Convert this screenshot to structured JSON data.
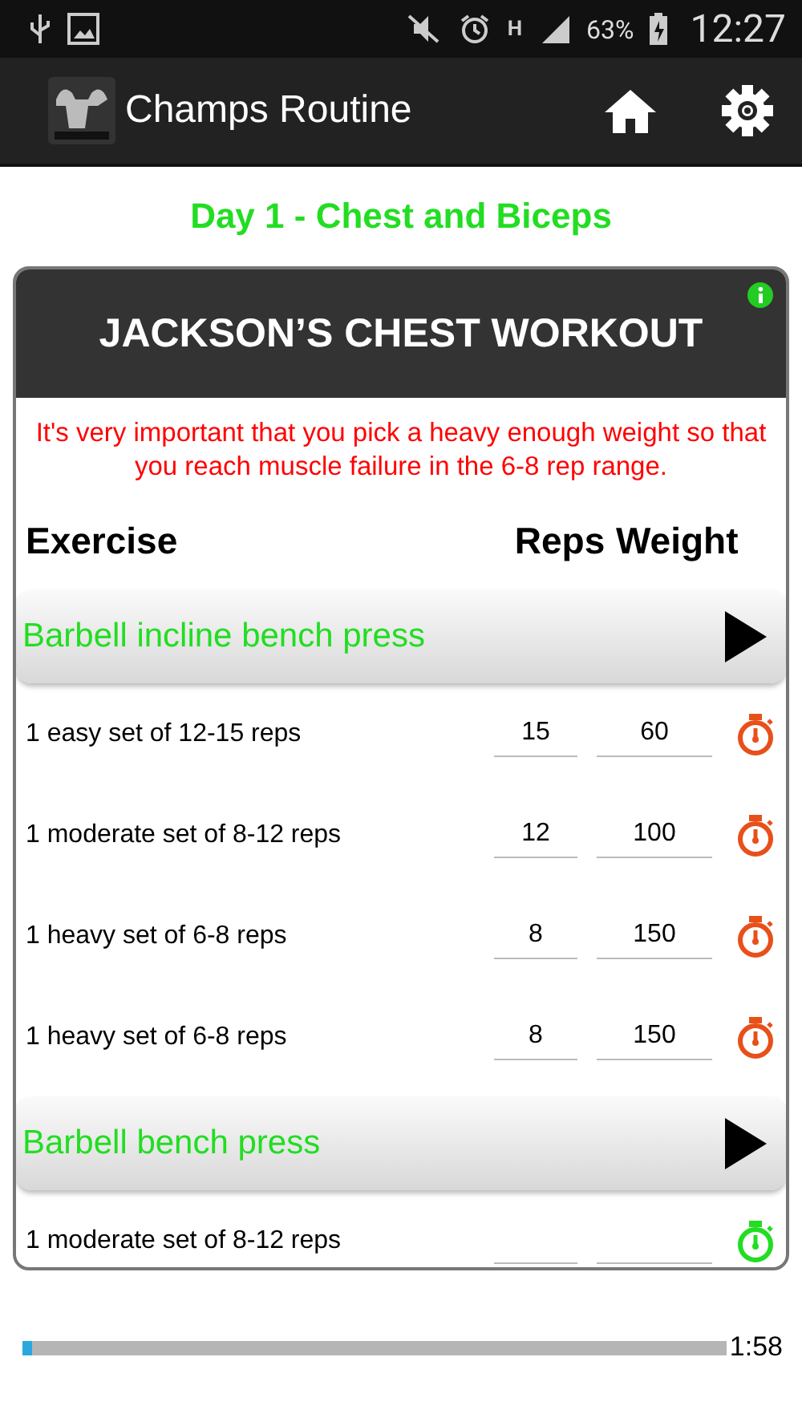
{
  "status_bar": {
    "battery_text": "63%",
    "network": "H",
    "time": "12:27"
  },
  "action_bar": {
    "title": "Champs Routine"
  },
  "day_title": "Day 1 - Chest and Biceps",
  "workout": {
    "title": "JACKSON’S CHEST WORKOUT",
    "note": "It's very important that you pick a heavy enough weight so that you reach muscle failure in the 6-8 rep range.",
    "columns": [
      "Exercise",
      "Reps",
      "Weight"
    ],
    "exercises": [
      {
        "name": "Barbell incline bench press",
        "sets": [
          {
            "label": "1 easy set of 12-15 reps",
            "reps": "15",
            "weight": "60",
            "color": "#e8501a"
          },
          {
            "label": "1 moderate set of 8-12 reps",
            "reps": "12",
            "weight": "100",
            "color": "#e8501a"
          },
          {
            "label": "1 heavy set of 6-8 reps",
            "reps": "8",
            "weight": "150",
            "color": "#e8501a"
          },
          {
            "label": "1 heavy set of 6-8 reps",
            "reps": "8",
            "weight": "150",
            "color": "#e8501a"
          }
        ]
      },
      {
        "name": "Barbell bench press",
        "sets": [
          {
            "label": "1 moderate set of 8-12 reps",
            "color": "#22dd22"
          }
        ]
      }
    ]
  },
  "timer": {
    "level": 0.01,
    "reading": "1:58"
  }
}
